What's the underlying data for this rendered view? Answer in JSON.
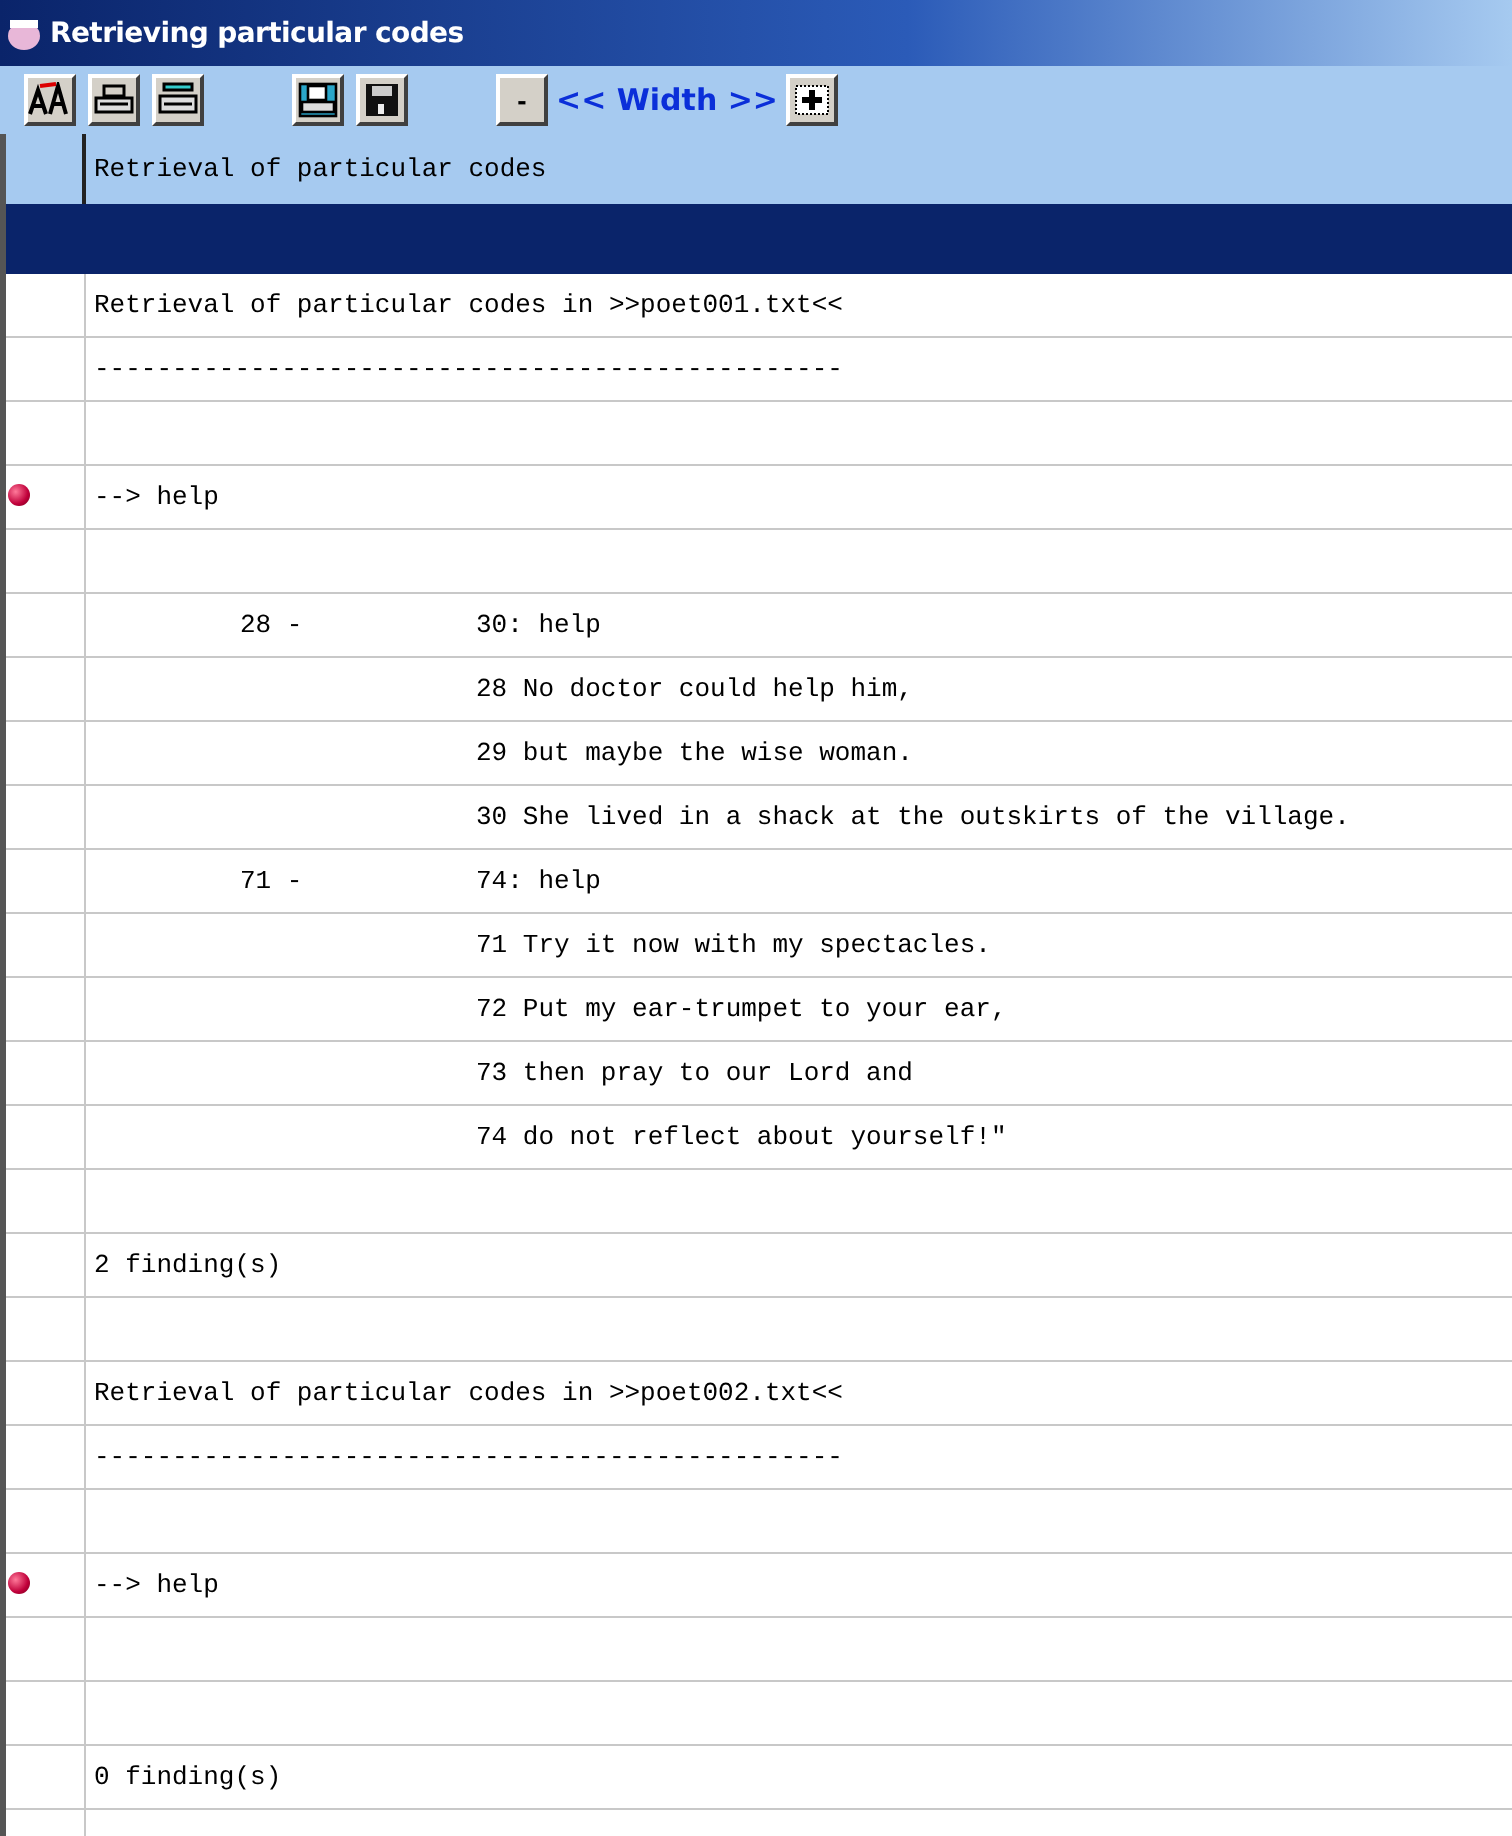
{
  "window": {
    "title": "Retrieving particular codes"
  },
  "toolbar": {
    "buttons": [
      {
        "kind": "font"
      },
      {
        "kind": "print"
      },
      {
        "kind": "print-setup"
      },
      {
        "kind": "gap"
      },
      {
        "kind": "preview"
      },
      {
        "kind": "save"
      },
      {
        "kind": "gap"
      },
      {
        "kind": "minus",
        "label": "-"
      },
      {
        "kind": "caption",
        "label": "<< Width >>"
      },
      {
        "kind": "plus"
      }
    ]
  },
  "header": {
    "text": "Retrieval of particular codes"
  },
  "selected_row": {
    "selected": true
  },
  "rows": [
    {
      "kind": "plain",
      "bullet": false,
      "text": "Retrieval of particular codes in >>poet001.txt<<"
    },
    {
      "kind": "plain",
      "bullet": false,
      "text": "------------------------------------------------"
    },
    {
      "kind": "blank",
      "bullet": false
    },
    {
      "kind": "plain",
      "bullet": true,
      "text": "--> help"
    },
    {
      "kind": "blank",
      "bullet": false
    },
    {
      "kind": "range",
      "bullet": false,
      "range": "28 -",
      "text": "30: help"
    },
    {
      "kind": "indented",
      "bullet": false,
      "text": "28 No doctor could help him,"
    },
    {
      "kind": "indented",
      "bullet": false,
      "text": "29 but maybe the wise woman."
    },
    {
      "kind": "indented",
      "bullet": false,
      "text": "30 She lived in a shack at the outskirts of the village."
    },
    {
      "kind": "range",
      "bullet": false,
      "range": "71 -",
      "text": "74: help"
    },
    {
      "kind": "indented",
      "bullet": false,
      "text": "71 Try it now with my spectacles."
    },
    {
      "kind": "indented",
      "bullet": false,
      "text": "72 Put my ear-trumpet to your ear,"
    },
    {
      "kind": "indented",
      "bullet": false,
      "text": "73 then pray to our Lord and"
    },
    {
      "kind": "indented",
      "bullet": false,
      "text": "74 do not reflect about yourself!\""
    },
    {
      "kind": "blank",
      "bullet": false
    },
    {
      "kind": "plain",
      "bullet": false,
      "text": "2 finding(s)"
    },
    {
      "kind": "blank",
      "bullet": false
    },
    {
      "kind": "plain",
      "bullet": false,
      "text": "Retrieval of particular codes in >>poet002.txt<<"
    },
    {
      "kind": "plain",
      "bullet": false,
      "text": "------------------------------------------------"
    },
    {
      "kind": "blank",
      "bullet": false
    },
    {
      "kind": "plain",
      "bullet": true,
      "text": "--> help"
    },
    {
      "kind": "blank",
      "bullet": false
    },
    {
      "kind": "blank",
      "bullet": false
    },
    {
      "kind": "plain",
      "bullet": false,
      "text": "0 finding(s)"
    },
    {
      "kind": "blank",
      "bullet": false
    }
  ]
}
